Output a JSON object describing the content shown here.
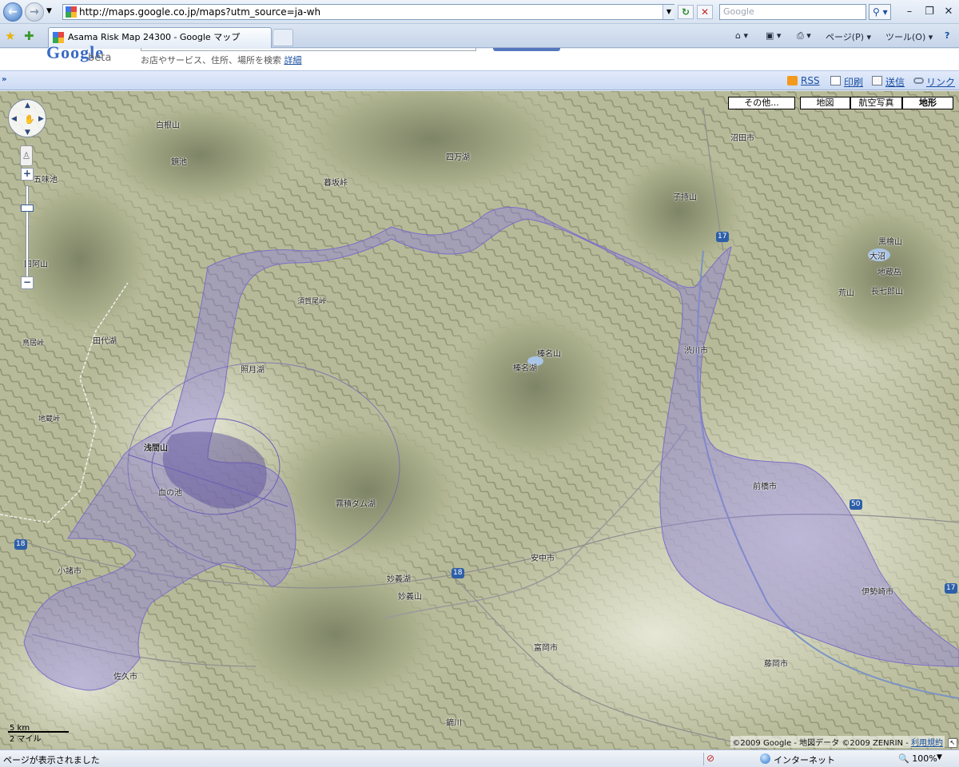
{
  "browser": {
    "url": "http://maps.google.co.jp/maps?utm_source=ja-wh",
    "search_placeholder": "Google",
    "tab_title": "Asama Risk Map 24300 - Google マップ",
    "commands": {
      "home": "⌂ ▾",
      "feeds": "▣ ▾",
      "print": "⎙ ▾",
      "page": "ページ(P) ▾",
      "tools": "ツール(O) ▾",
      "help": "?"
    },
    "window_buttons": {
      "minimize": "–",
      "maximize": "❐",
      "close": "✕"
    }
  },
  "google_header": {
    "logo": "Google",
    "beta": "beta",
    "search_hint": "お店やサービス、住所、場所を検索",
    "detail_link": "詳細"
  },
  "link_bar": {
    "collapse": "»",
    "rss": "RSS",
    "print": "印刷",
    "send": "送信",
    "link": "リンク"
  },
  "map": {
    "map_types": {
      "more": "その他...",
      "map": "地図",
      "satellite": "航空写真",
      "terrain": "地形"
    },
    "selected_map_type": "地形",
    "zoom_controls": {
      "plus": "+",
      "minus": "−"
    },
    "scale": {
      "km": "5 km",
      "miles": "2 マイル"
    },
    "copyright": "©2009 Google - 地図データ ©2009 ZENRIN -",
    "terms_link": "利用規約",
    "labels": {
      "shirane": "白根山",
      "kagami": "鏡池",
      "goshiki": "五味池",
      "shimanta": "四万湖",
      "mokuzai": "暮坂峠",
      "komochi": "子持山",
      "numata": "沼田市",
      "azuma": "吾妻山",
      "onuma": "大沼",
      "kurohime": "黒檜山",
      "jizo_kirishima": "地蔵岳",
      "choshichi": "長七郎山",
      "arayama": "荒山",
      "asoyama": "四阿山",
      "tashiro": "田代湖",
      "torii": "鳥居峠",
      "suganao": "須賀尾峠",
      "terutsuki": "照月湖",
      "haruna_san": "榛名山",
      "haruna_ko": "榛名湖",
      "shibukawa": "渋川市",
      "jizo_toge": "地蔵峠",
      "asama": "浅間山",
      "chinoike": "血の池",
      "kirizumi": "霧積ダム湖",
      "maebashi": "前橋市",
      "annaka": "安中市",
      "komoro": "小諸市",
      "myogi_ko": "妙義湖",
      "myogi_san": "妙義山",
      "isesaki": "伊勢崎市",
      "tomioka": "富岡市",
      "saku": "佐久市",
      "fujioka": "藤岡市",
      "kaburagawa": "鏑川",
      "route17": "17",
      "route18a": "18",
      "route18b": "18",
      "route50": "50",
      "route17b": "17"
    },
    "hazard_overlay_color": "#8c7fd9"
  },
  "status_bar": {
    "text": "ページが表示されました",
    "zone": "インターネット",
    "zoom": "100%"
  }
}
